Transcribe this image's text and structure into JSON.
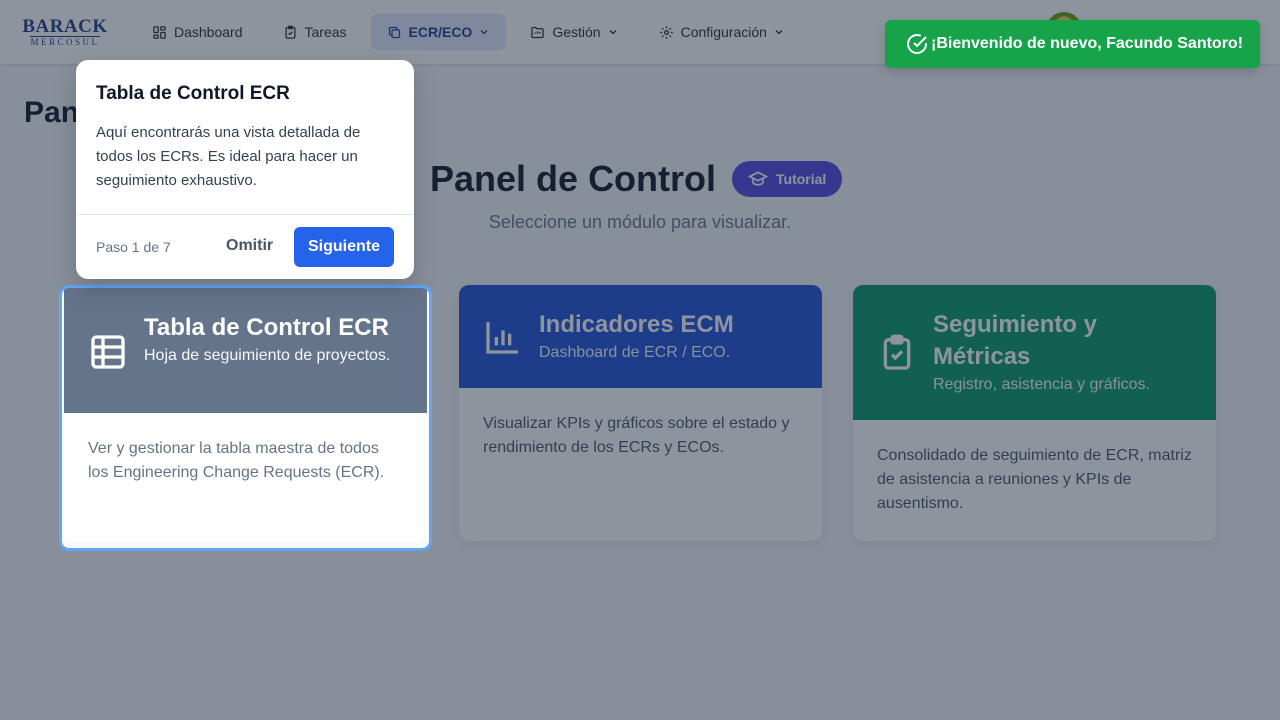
{
  "brand": {
    "top": "BARACK",
    "bottom": "MERCOSUL"
  },
  "nav": {
    "dashboard": "Dashboard",
    "tareas": "Tareas",
    "ecr_eco": "ECR/ECO",
    "gestion": "Gestión",
    "configuracion": "Configuración"
  },
  "page": {
    "heading": "Panel de Control",
    "title": "Panel de Control",
    "tutorial_label": "Tutorial",
    "subtitle": "Seleccione un módulo para visualizar."
  },
  "cards": [
    {
      "title": "Tabla de Control ECR",
      "subtitle": "Hoja de seguimiento de proyectos.",
      "body": "Ver y gestionar la tabla maestra de todos los Engineering Change Requests (ECR)."
    },
    {
      "title": "Indicadores ECM",
      "subtitle": "Dashboard de ECR / ECO.",
      "body": "Visualizar KPIs y gráficos sobre el estado y rendimiento de los ECRs y ECOs."
    },
    {
      "title": "Seguimiento y Métricas",
      "subtitle": "Registro, asistencia y gráficos.",
      "body": "Consolidado de seguimiento de ECR, matriz de asistencia a reuniones y KPIs de ausentismo."
    }
  ],
  "tour": {
    "title": "Tabla de Control ECR",
    "text": "Aquí encontrarás una vista detallada de todos los ECRs. Es ideal para hacer un seguimiento exhaustivo.",
    "step": "Paso 1 de 7",
    "skip": "Omitir",
    "next": "Siguiente"
  },
  "toast": {
    "message": "¡Bienvenido de nuevo, Facundo Santoro!"
  },
  "colors": {
    "primary": "#2563eb",
    "tutorial": "#4f46e5",
    "card_ecr": "#334155",
    "card_ecm": "#1d4ed8",
    "card_metrics": "#059669",
    "toast": "#16a34a"
  }
}
